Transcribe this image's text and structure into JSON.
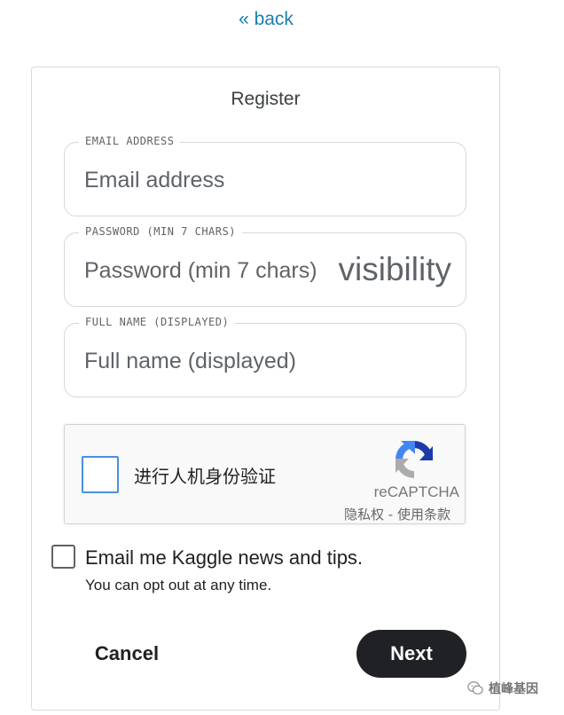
{
  "nav": {
    "back_label": "« back"
  },
  "form": {
    "title": "Register",
    "email": {
      "legend": "EMAIL ADDRESS",
      "placeholder": "Email address",
      "value": ""
    },
    "password": {
      "legend": "PASSWORD (MIN 7 CHARS)",
      "placeholder": "Password (min 7 chars)",
      "value": "",
      "visibility_icon_text": "visibility"
    },
    "full_name": {
      "legend": "FULL NAME (DISPLAYED)",
      "placeholder": "Full name (displayed)",
      "value": ""
    }
  },
  "recaptcha": {
    "checkbox_label": "进行人机身份验证",
    "brand": "reCAPTCHA",
    "privacy_link": "隐私权",
    "separator": " - ",
    "terms_link": "使用条款",
    "checked": false
  },
  "optin": {
    "label": "Email me Kaggle news and tips.",
    "sublabel": "You can opt out at any time.",
    "checked": false
  },
  "actions": {
    "cancel_label": "Cancel",
    "next_label": "Next"
  },
  "watermark": {
    "text": "植峰基因",
    "icon": "wechat-icon"
  },
  "colors": {
    "link": "#1a7fb0",
    "primary_button": "#202124",
    "recaptcha_checkbox_border": "#4a90e2",
    "border": "#d6d7d9"
  }
}
